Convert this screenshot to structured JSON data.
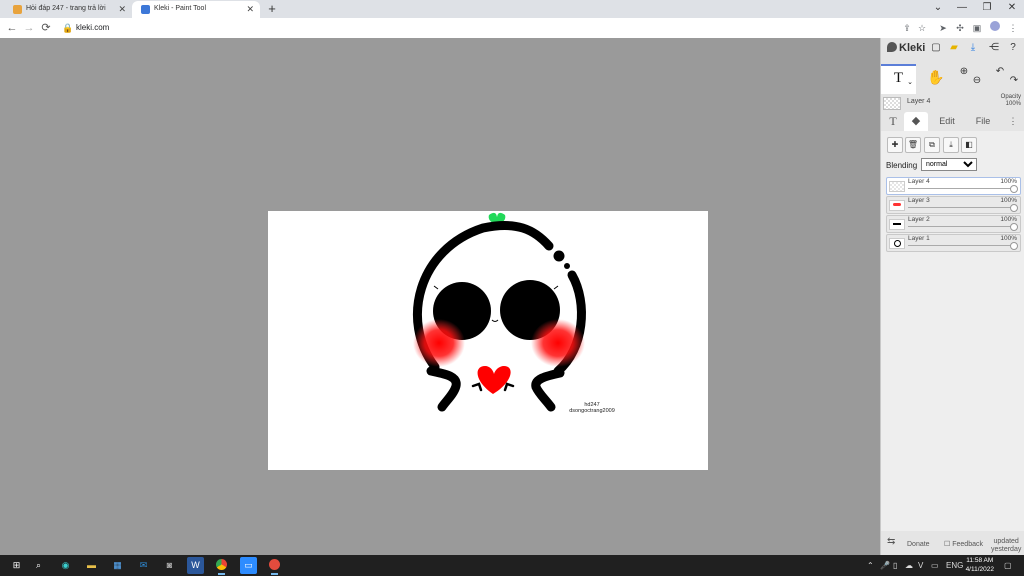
{
  "browser": {
    "tabs": [
      {
        "title": "Hỏi đáp 247 - trang trả lời",
        "favicon_color": "#e8a33d",
        "active": false
      },
      {
        "title": "Kleki - Paint Tool",
        "favicon_color": "#3d78d8",
        "active": true
      }
    ],
    "new_tab_icon": "+",
    "window_controls": [
      "⌄",
      "—",
      "❐",
      "✕"
    ],
    "url": "kleki.com"
  },
  "canvas": {
    "signature_lines": [
      "hd247",
      "dsongoctrang2009"
    ],
    "colors": {
      "stroke": "#000000",
      "blush": "#ff0000",
      "sprout": "#22d95a"
    }
  },
  "panel": {
    "logo": "Kleki",
    "tool_name": "T",
    "current_layer": "Layer 4",
    "opacity_label": "Opacity",
    "opacity_value": "100%",
    "tabs": [
      "Edit",
      "File"
    ],
    "blending_label": "Blending",
    "blending_value": "normal",
    "blending_options": [
      "normal"
    ],
    "layers": [
      {
        "name": "Layer 4",
        "opacity": "100%"
      },
      {
        "name": "Layer 3",
        "opacity": "100%"
      },
      {
        "name": "Layer 2",
        "opacity": "100%"
      },
      {
        "name": "Layer 1",
        "opacity": "100%"
      }
    ],
    "footer": {
      "donate": "Donate",
      "feedback": "Feedback",
      "updated": "updated",
      "updated_when": "yesterday"
    }
  },
  "taskbar": {
    "lang": "ENG",
    "time": "11:58 AM",
    "date": "4/11/2022"
  }
}
